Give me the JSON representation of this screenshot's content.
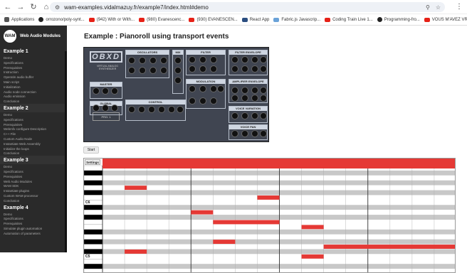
{
  "browser": {
    "url": "wam-examples.vidalmazuy.fr/example7/index.html#demo",
    "bookmarks": [
      "Applications",
      "orrozono/poly-synt...",
      "(942) With or With...",
      "(980) Evanescenc...",
      "(930) EVANESCEN...",
      "React App",
      "Fabric.js Javascrip...",
      "Coding Train Live 1...",
      "Programming-fro...",
      "VOUS M'AVEZ VR..."
    ],
    "bookmark_icons": [
      "apps",
      "gh",
      "yt",
      "yt",
      "yt",
      "ra",
      "fx",
      "yt",
      "gh",
      "yt"
    ]
  },
  "sidebar": {
    "brand": "Web Audio Modules",
    "logo_text": "WAM",
    "sections": [
      {
        "title": "Example 1",
        "items": [
          "Demo",
          "Specifications",
          "Prerequisites",
          "Instruction",
          "Operatin audio buffer",
          "Main script",
          "Initialization",
          "Audio node connection",
          "Audio emission",
          "Conclusion"
        ]
      },
      {
        "title": "Example 2",
        "items": [
          "Demo",
          "Specifications",
          "Prerequisites",
          "Webmfx configure Description",
          "C++ File",
          "Custom Audio Node",
          "Instantiate Web Assembly",
          "Initialize the loops",
          "Conclusion"
        ]
      },
      {
        "title": "Example 3",
        "items": [
          "Demo",
          "Specifications",
          "Prerequisites",
          "Web Audio Modules",
          "WAM SDK",
          "Instantiate plugins",
          "Custom WAM processor",
          "Conclusion"
        ]
      },
      {
        "title": "Example 4",
        "items": [
          "Demo",
          "Specifications",
          "Prerequisites",
          "Simulate plugin automation",
          "Automation of parameters"
        ]
      }
    ]
  },
  "main": {
    "title": "Example : Pianoroll using transport events",
    "start_label": "Start",
    "settings_label": "Settings"
  },
  "synth": {
    "logo": "OBXD",
    "subtitle": "VIRTUAL ANALOG SYNTHESIZER",
    "lcd": "PRG: 1",
    "panels": [
      "OSCILLATORS",
      "MIX",
      "FILTER",
      "FILTER ENVELOPE",
      "MASTER",
      "AMPLIFIER ENVELOPE",
      "MODULATION",
      "GLOBAL",
      "VOICE VARIATION",
      "CONTROL",
      "VOICE PAN"
    ]
  },
  "pianoroll": {
    "octave_labels": [
      "C6",
      "C5"
    ],
    "rows": 22,
    "columns": 16,
    "beats_per_bar": 4,
    "notes": [
      {
        "row": 0,
        "start": 0,
        "len": 16
      },
      {
        "row": 4,
        "start": 1,
        "len": 1
      },
      {
        "row": 6,
        "start": 7,
        "len": 1
      },
      {
        "row": 9,
        "start": 4,
        "len": 1
      },
      {
        "row": 11,
        "start": 5,
        "len": 3
      },
      {
        "row": 12,
        "start": 9,
        "len": 1
      },
      {
        "row": 15,
        "start": 5,
        "len": 1
      },
      {
        "row": 16,
        "start": 10,
        "len": 6
      },
      {
        "row": 17,
        "start": 1,
        "len": 1
      },
      {
        "row": 18,
        "start": 9,
        "len": 1
      }
    ],
    "colors": {
      "note": "#e53935",
      "white": "#ffffff",
      "gray": "#c8c8c8",
      "black_key": "#000000"
    }
  },
  "colors": {
    "sidebar_bg": "#2a2a2a",
    "synth_bg": "#404551",
    "accent_red": "#e53935"
  }
}
